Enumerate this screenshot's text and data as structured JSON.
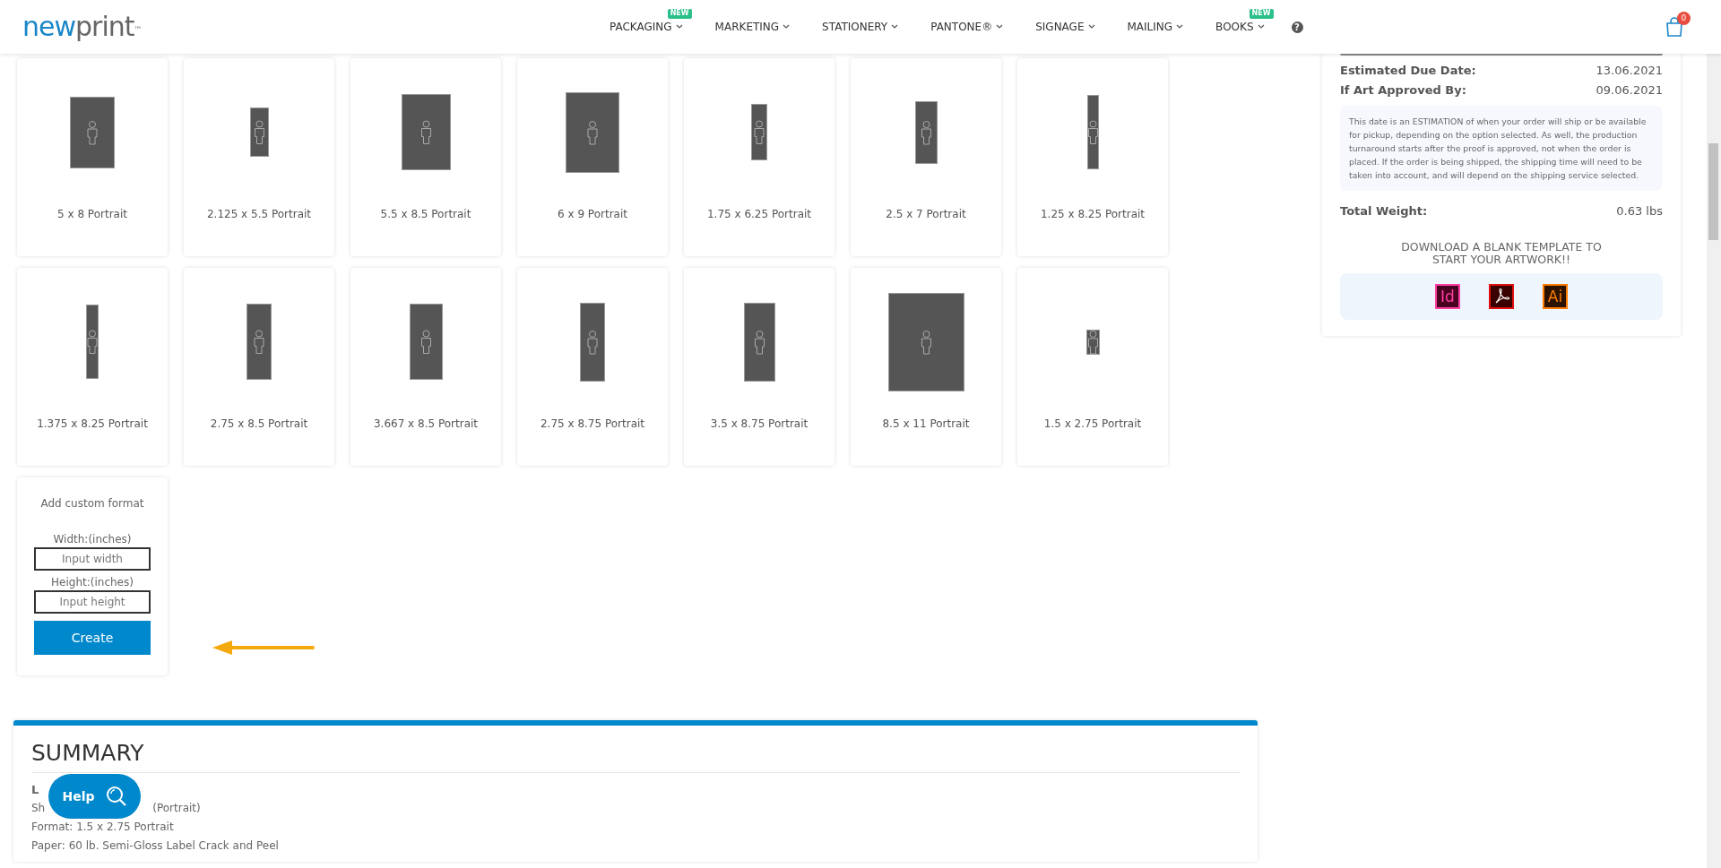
{
  "header": {
    "logo": {
      "parts": [
        "new",
        "print"
      ],
      "mark": "™"
    },
    "nav": [
      {
        "label": "PACKAGING",
        "badge": "NEW"
      },
      {
        "label": "MARKETING"
      },
      {
        "label": "STATIONERY"
      },
      {
        "label": "PANTONE®"
      },
      {
        "label": "SIGNAGE"
      },
      {
        "label": "MAILING"
      },
      {
        "label": "BOOKS",
        "badge": "NEW"
      }
    ],
    "help_mark": "?",
    "cart_count": "0"
  },
  "formats": [
    {
      "label": "5 x 8 Portrait"
    },
    {
      "label": "2.125 x 5.5 Portrait"
    },
    {
      "label": "5.5 x 8.5 Portrait"
    },
    {
      "label": "6 x 9 Portrait"
    },
    {
      "label": "1.75 x 6.25 Portrait"
    },
    {
      "label": "2.5 x 7 Portrait"
    },
    {
      "label": "1.25 x 8.25 Portrait"
    },
    {
      "label": "1.375 x 8.25 Portrait"
    },
    {
      "label": "2.75 x 8.5 Portrait"
    },
    {
      "label": "3.667 x 8.5 Portrait"
    },
    {
      "label": "2.75 x 8.75 Portrait"
    },
    {
      "label": "3.5 x 8.75 Portrait"
    },
    {
      "label": "8.5 x 11 Portrait"
    },
    {
      "label": "1.5 x 2.75 Portrait"
    }
  ],
  "custom_format": {
    "title": "Add custom format",
    "width_label": "Width:(inches)",
    "width_placeholder": "Input width",
    "height_label": "Height:(inches)",
    "height_placeholder": "Input height",
    "button": "Create"
  },
  "summary": {
    "title": "SUMMARY",
    "lines": [
      {
        "kind": "heading",
        "parts": [
          "L"
        ]
      },
      {
        "kind": "text",
        "parts": [
          "Sh",
          "(Portrait)"
        ]
      },
      {
        "kind": "text",
        "parts": [
          "Format: 1.5 x 2.75 Portrait"
        ]
      },
      {
        "kind": "text",
        "parts": [
          "Paper: 60 lb. Semi-Gloss Label Crack and Peel"
        ]
      }
    ]
  },
  "help_button": "Help",
  "order_panel": {
    "rows": [
      {
        "label": "Estimated Due Date:",
        "value": "13.06.2021"
      },
      {
        "label": "If Art Approved By:",
        "value": "09.06.2021"
      }
    ],
    "note": "This date is an ESTIMATION of when your order will ship or be available for pickup, depending on the option selected. As well, the production turnaround starts after the proof is approved, not when the order is placed. If the order is being shipped, the shipping time will need to be taken into account, and will depend on the shipping service selected.",
    "weight": {
      "label": "Total Weight:",
      "value": "0.63 lbs"
    },
    "download_title": "DOWNLOAD A BLANK TEMPLATE TO START YOUR ARTWORK!!",
    "templates": [
      {
        "kind": "indesign",
        "text": "Id"
      },
      {
        "kind": "pdf"
      },
      {
        "kind": "illustrator",
        "text": "Ai"
      }
    ]
  }
}
